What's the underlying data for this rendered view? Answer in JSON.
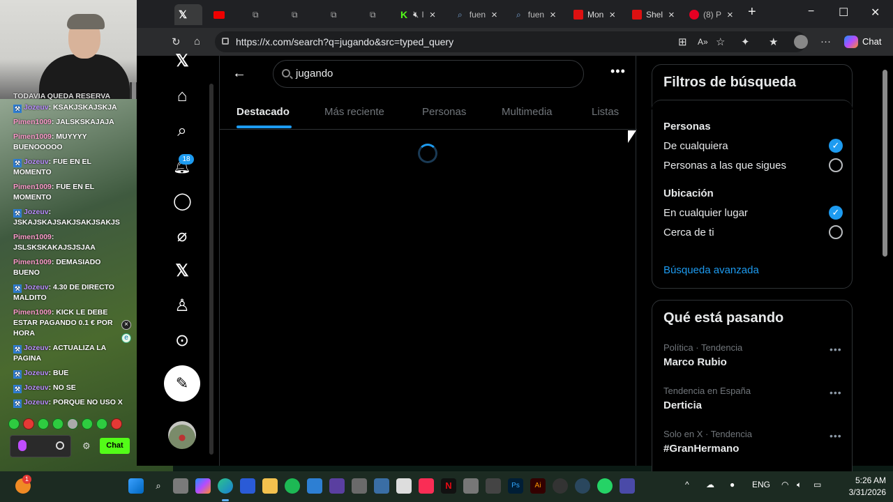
{
  "browser": {
    "tabs": [
      {
        "label": "",
        "icon": "x-logo-icon",
        "active": true
      },
      {
        "label": "",
        "icon": "youtube-icon"
      },
      {
        "label": "",
        "icon": "extension-icon"
      },
      {
        "label": "",
        "icon": "extension-icon"
      },
      {
        "label": "",
        "icon": "extension-icon"
      },
      {
        "label": "",
        "icon": "extension-icon"
      },
      {
        "label": "I",
        "icon": "kick-icon",
        "muted": true
      },
      {
        "label": "fuen",
        "icon": "search-icon"
      },
      {
        "label": "fuen",
        "icon": "search-icon"
      },
      {
        "label": "Mon",
        "icon": "flag-red-icon"
      },
      {
        "label": "Shel",
        "icon": "flag-red-icon"
      },
      {
        "label": "(8) P",
        "icon": "pinterest-icon"
      }
    ],
    "url": "https://x.com/search?q=jugando&src=typed_query",
    "copilot_label": "Chat"
  },
  "x_nav": {
    "notification_count": "18",
    "items": [
      "x-logo-icon",
      "home-icon",
      "search-icon",
      "bell-icon",
      "messages-icon",
      "grok-icon",
      "x-logo-icon",
      "profile-icon",
      "more-circle-icon"
    ]
  },
  "search": {
    "query": "jugando",
    "tabs": [
      "Destacado",
      "Más reciente",
      "Personas",
      "Multimedia",
      "Listas"
    ],
    "active_tab": "Destacado"
  },
  "filters": {
    "title": "Filtros de búsqueda",
    "people_heading": "Personas",
    "people_options": [
      {
        "label": "De cualquiera",
        "selected": true
      },
      {
        "label": "Personas a las que sigues",
        "selected": false
      }
    ],
    "location_heading": "Ubicación",
    "location_options": [
      {
        "label": "En cualquier lugar",
        "selected": true
      },
      {
        "label": "Cerca de ti",
        "selected": false
      }
    ],
    "advanced_link": "Búsqueda avanzada"
  },
  "trends": {
    "title": "Qué está pasando",
    "items": [
      {
        "meta": "Política · Tendencia",
        "name": "Marco Rubio"
      },
      {
        "meta": "Tendencia en España",
        "name": "Derticia"
      },
      {
        "meta": "Solo en X · Tendencia",
        "name": "#GranHermano"
      }
    ]
  },
  "stream_chat": {
    "partial_top": "TODAVIA QUEDA RESERVA",
    "messages": [
      {
        "user": "Jozeuv",
        "text": ": KSAKJSKAJSKJA",
        "badge": true
      },
      {
        "user": "Pimen1009",
        "text": ": JALSKSKAJAJA",
        "badge": false
      },
      {
        "user": "Pimen1009",
        "text": ": MUYYYY BUENOOOOO",
        "badge": false
      },
      {
        "user": "Jozeuv",
        "text": ": FUE EN EL MOMENTO",
        "badge": true
      },
      {
        "user": "Pimen1009",
        "text": ": FUE EN EL MOMENTO",
        "badge": false
      },
      {
        "user": "Jozeuv",
        "text": ": JSKAJSKAJSAKJSAKJSAKJS",
        "badge": true
      },
      {
        "user": "Pimen1009",
        "text": ": JSLSKSKAKAJSJSJAA",
        "badge": false
      },
      {
        "user": "Pimen1009",
        "text": ": DEMASIADO BUENO",
        "badge": false
      },
      {
        "user": "Jozeuv",
        "text": ": 4.30 DE DIRECTO MALDITO",
        "badge": true
      },
      {
        "user": "Pimen1009",
        "text": ": KICK LE DEBE ESTAR PAGANDO 0.1 € POR HORA",
        "badge": false
      },
      {
        "user": "Jozeuv",
        "text": ": ACTUALIZA LA PAGINA",
        "badge": true
      },
      {
        "user": "Jozeuv",
        "text": ": BUE",
        "badge": true
      },
      {
        "user": "Jozeuv",
        "text": ": NO SE",
        "badge": true
      },
      {
        "user": "Jozeuv",
        "text": ": PORQUE NO USO X",
        "badge": true
      }
    ],
    "send_label": "Chat"
  },
  "taskbar": {
    "language": "ENG",
    "time": "5:26 AM",
    "date": "3/31/2026",
    "badge": "1"
  },
  "colors": {
    "accent": "#1d9bf0",
    "kick_green": "#53fc18",
    "background": "#000000"
  }
}
